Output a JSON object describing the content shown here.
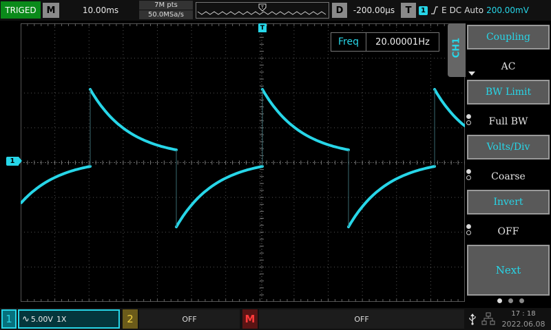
{
  "top_bar": {
    "trigger_status": "TRIGED",
    "mode_label": "M",
    "timebase": "10.00ms",
    "memory_depth": "7M pts",
    "sample_rate": "50.0MSa/s",
    "trigger_position_marker": "T",
    "delay_label": "D",
    "delay_value": "-200.00μs",
    "trigger_label": "T",
    "trigger_channel": "1",
    "trigger_slope_icon": "rising-edge-icon",
    "trigger_type": "E",
    "trigger_coupling": "DC",
    "trigger_mode": "Auto",
    "trigger_level": "200.00mV"
  },
  "screen": {
    "trigger_marker": "T",
    "channel_level_marker": "1",
    "trace_color": "#27d6e8",
    "grid_divisions": {
      "horizontal": 13,
      "vertical": 8
    },
    "measurement": {
      "label": "Freq",
      "value": "20.00001Hz"
    },
    "channel_tab": "CH1"
  },
  "menu": {
    "items": [
      {
        "label": "Coupling",
        "value": "AC"
      },
      {
        "label": "BW Limit",
        "value": "Full BW"
      },
      {
        "label": "Volts/Div",
        "value": "Coarse"
      },
      {
        "label": "Invert",
        "value": "OFF"
      }
    ],
    "next_label": "Next",
    "pages": 3,
    "current_page": 1
  },
  "bottom_bar": {
    "ch1": {
      "number": "1",
      "coupling_icon": "ac-coupling-icon",
      "coupling_symbol": "∿",
      "scale": "5.00V",
      "probe": "1X"
    },
    "ch2": {
      "number": "2",
      "status": "OFF"
    },
    "math": {
      "label": "M",
      "status": "OFF"
    },
    "usb_icon": "usb-icon",
    "usb_symbol": "⭍",
    "network_icon": "network-icon",
    "time": "17 : 18",
    "date": "2022.06.08"
  }
}
